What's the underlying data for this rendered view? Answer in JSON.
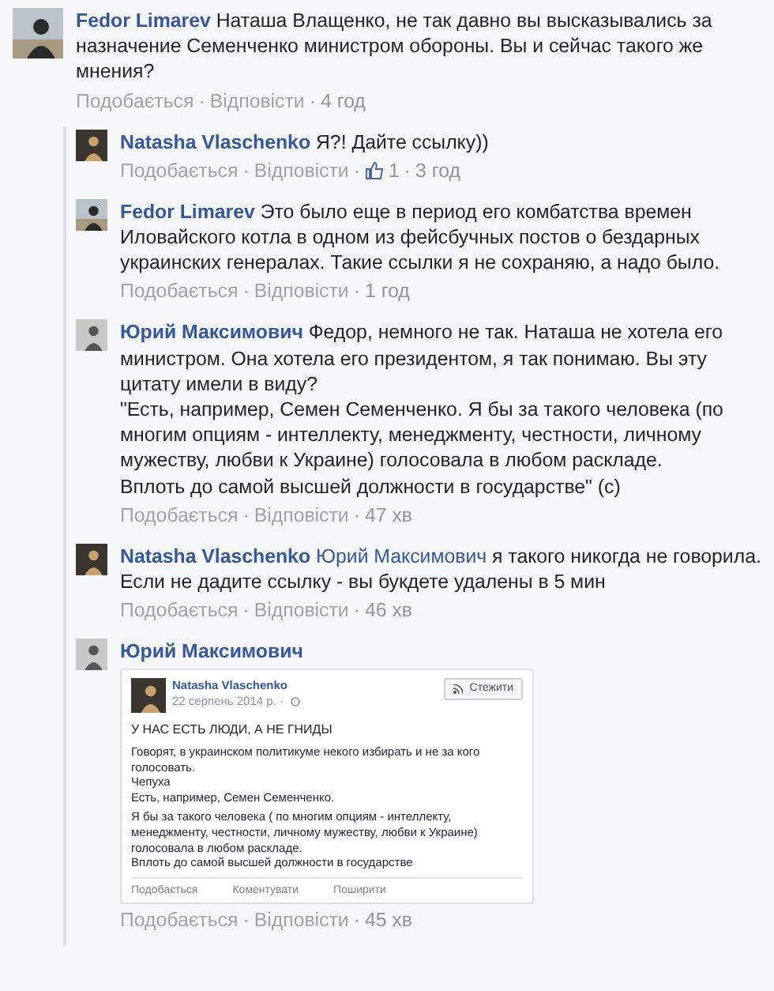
{
  "comment": {
    "author": "Fedor Limarev",
    "text": "Наташа Влащенко, не так давно вы высказывались за назначение Семенченко министром обороны. Вы и сейчас такого же мнения?",
    "meta": [
      {
        "kind": "like",
        "text": "Подобається"
      },
      {
        "kind": "dot",
        "text": "·"
      },
      {
        "kind": "reply",
        "text": "Відповісти"
      },
      {
        "kind": "dot",
        "text": "·"
      },
      {
        "kind": "time",
        "text": "4 год"
      }
    ],
    "replies": [
      {
        "author": "Natasha Vlaschenko",
        "text": "Я?! Дайте ссылку))",
        "meta": [
          {
            "kind": "like",
            "text": "Подобається"
          },
          {
            "kind": "dot",
            "text": "·"
          },
          {
            "kind": "reply",
            "text": "Відповісти"
          },
          {
            "kind": "dot",
            "text": "·"
          },
          {
            "kind": "likes",
            "text": "1"
          },
          {
            "kind": "dot",
            "text": "·"
          },
          {
            "kind": "time",
            "text": "3 год"
          }
        ]
      },
      {
        "author": "Fedor Limarev",
        "text": "Это было еще в период его комбатства времен Иловайского котла в одном из фейсбучных постов о бездарных украинских генералах. Такие ссылки я не сохраняю, а надо было.",
        "meta": [
          {
            "kind": "like",
            "text": "Подобається"
          },
          {
            "kind": "dot",
            "text": "·"
          },
          {
            "kind": "reply",
            "text": "Відповісти"
          },
          {
            "kind": "dot",
            "text": "·"
          },
          {
            "kind": "time",
            "text": "1 год"
          }
        ]
      },
      {
        "author": "Юрий Максимович",
        "text": "Федор, немного не так. Наташа не хотела его министром. Она хотела его президентом, я так понимаю. Вы эту цитату имели в виду?\n\"Есть, например, Семен Семенченко. Я бы за такого человека (по многим опциям - интеллекту, менеджменту, честности, личному мужеству, любви к Украине) голосовала в любом раскладе.\nВплоть до самой высшей должности в государстве\" (с)",
        "meta": [
          {
            "kind": "like",
            "text": "Подобається"
          },
          {
            "kind": "dot",
            "text": "·"
          },
          {
            "kind": "reply",
            "text": "Відповісти"
          },
          {
            "kind": "dot",
            "text": "·"
          },
          {
            "kind": "time",
            "text": "47 хв"
          }
        ]
      },
      {
        "author": "Natasha Vlaschenko",
        "mention": "Юрий Максимович",
        "text": "я такого никогда не говорила. Если не дадите ссылку - вы букдете удалены в 5 мин",
        "meta": [
          {
            "kind": "like",
            "text": "Подобається"
          },
          {
            "kind": "dot",
            "text": "·"
          },
          {
            "kind": "reply",
            "text": "Відповісти"
          },
          {
            "kind": "dot",
            "text": "·"
          },
          {
            "kind": "time",
            "text": "46 хв"
          }
        ]
      },
      {
        "author": "Юрий Максимович",
        "attachment": {
          "author": "Natasha Vlaschenko",
          "date": "22 серпень 2014 р. ·",
          "follow": "Стежити",
          "title": "У НАС ЕСТЬ ЛЮДИ, А НЕ ГНИДЫ",
          "paragraphs": [
            "Говорят, в украинском политикуме некого избирать и не за кого голосовать.\nЧепуха\nЕсть, например, Семен Семенченко.",
            "Я бы за такого человека ( по многим опциям - интеллекту, менеджменту, честности, личному мужеству, любви к Украине) голосовала в любом раскладе.\nВплоть до самой высшей должности в государстве"
          ],
          "actions": [
            "Подобається",
            "Коментувати",
            "Поширити"
          ]
        },
        "meta": [
          {
            "kind": "like",
            "text": "Подобається"
          },
          {
            "kind": "dot",
            "text": "·"
          },
          {
            "kind": "reply",
            "text": "Відповісти"
          },
          {
            "kind": "dot",
            "text": "·"
          },
          {
            "kind": "time",
            "text": "45 хв"
          }
        ]
      }
    ]
  }
}
